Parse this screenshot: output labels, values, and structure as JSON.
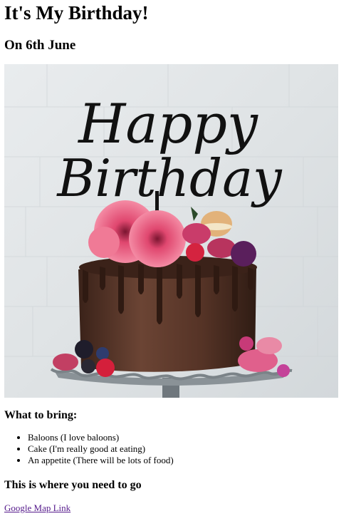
{
  "title": "It's My Birthday!",
  "date_heading": "On 6th June",
  "image": {
    "topper_line1": "Happy",
    "topper_line2": "Birthday"
  },
  "bring_heading": "What to bring:",
  "bring_items": [
    "Baloons (I love baloons)",
    "Cake (I'm really good at eating)",
    "An appetite (There will be lots of food)"
  ],
  "location_heading": "This is where you need to go",
  "map_link": "Google Map Link"
}
